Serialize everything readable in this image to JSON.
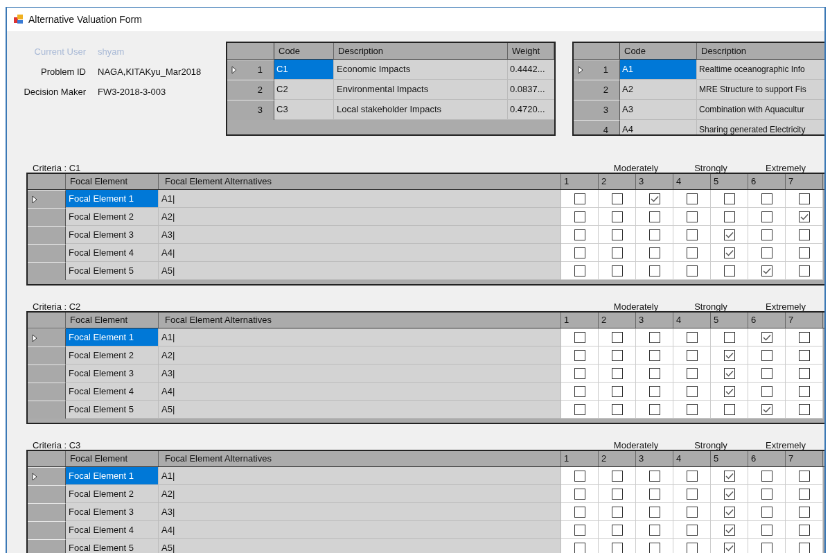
{
  "window": {
    "title": "Alternative Valuation Form"
  },
  "info": [
    {
      "label": "Current User",
      "value": "shyam",
      "disabled": true
    },
    {
      "label": "Problem ID",
      "value": "NAGA,KITAKyu_Mar2018",
      "disabled": false
    },
    {
      "label": "Decision Maker",
      "value": "FW3-2018-3-003",
      "disabled": false
    }
  ],
  "criteria_table": {
    "columns": [
      "Code",
      "Description",
      "Weight"
    ],
    "rows": [
      {
        "number": "1",
        "code": "C1",
        "description": "Economic Impacts",
        "weight": "0.4442...",
        "selected": true
      },
      {
        "number": "2",
        "code": "C2",
        "description": "Environmental Impacts",
        "weight": "0.0837...",
        "selected": false
      },
      {
        "number": "3",
        "code": "C3",
        "description": "Local stakeholder Impacts",
        "weight": "0.4720...",
        "selected": false
      }
    ]
  },
  "alternatives_table": {
    "columns": [
      "Code",
      "Description"
    ],
    "rows": [
      {
        "number": "1",
        "code": "A1",
        "description": "Realtime oceanographic Info",
        "selected": true
      },
      {
        "number": "2",
        "code": "A2",
        "description": "MRE Structure to support Fis",
        "selected": false
      },
      {
        "number": "3",
        "code": "A3",
        "description": "Combination with Aquacultur",
        "selected": false
      },
      {
        "number": "4",
        "code": "A4",
        "description": "Sharing generated Electricity",
        "selected": false
      }
    ]
  },
  "sections": [
    {
      "title": "Criteria : C1",
      "scale_labels": [
        "Moderately",
        "Strongly",
        "Extremely"
      ],
      "columns": [
        "Focal Element",
        "Focal Element Alternatives",
        "1",
        "2",
        "3",
        "4",
        "5",
        "6",
        "7"
      ],
      "rows": [
        {
          "element": "Focal Element 1",
          "alternatives": "A1|",
          "selected": true,
          "ratings": [
            false,
            false,
            true,
            false,
            false,
            false,
            false
          ]
        },
        {
          "element": "Focal Element 2",
          "alternatives": "A2|",
          "selected": false,
          "ratings": [
            false,
            false,
            false,
            false,
            false,
            false,
            true
          ]
        },
        {
          "element": "Focal Element 3",
          "alternatives": "A3|",
          "selected": false,
          "ratings": [
            false,
            false,
            false,
            false,
            true,
            false,
            false
          ]
        },
        {
          "element": "Focal Element 4",
          "alternatives": "A4|",
          "selected": false,
          "ratings": [
            false,
            false,
            false,
            false,
            true,
            false,
            false
          ]
        },
        {
          "element": "Focal Element 5",
          "alternatives": "A5|",
          "selected": false,
          "ratings": [
            false,
            false,
            false,
            false,
            false,
            true,
            false
          ]
        }
      ]
    },
    {
      "title": "Criteria : C2",
      "scale_labels": [
        "Moderately",
        "Strongly",
        "Extremely"
      ],
      "columns": [
        "Focal Element",
        "Focal Element Alternatives",
        "1",
        "2",
        "3",
        "4",
        "5",
        "6",
        "7"
      ],
      "rows": [
        {
          "element": "Focal Element 1",
          "alternatives": "A1|",
          "selected": true,
          "ratings": [
            false,
            false,
            false,
            false,
            false,
            true,
            false
          ]
        },
        {
          "element": "Focal Element 2",
          "alternatives": "A2|",
          "selected": false,
          "ratings": [
            false,
            false,
            false,
            false,
            true,
            false,
            false
          ]
        },
        {
          "element": "Focal Element 3",
          "alternatives": "A3|",
          "selected": false,
          "ratings": [
            false,
            false,
            false,
            false,
            true,
            false,
            false
          ]
        },
        {
          "element": "Focal Element 4",
          "alternatives": "A4|",
          "selected": false,
          "ratings": [
            false,
            false,
            false,
            false,
            true,
            false,
            false
          ]
        },
        {
          "element": "Focal Element 5",
          "alternatives": "A5|",
          "selected": false,
          "ratings": [
            false,
            false,
            false,
            false,
            false,
            true,
            false
          ]
        }
      ]
    },
    {
      "title": "Criteria : C3",
      "scale_labels": [
        "Moderately",
        "Strongly",
        "Extremely"
      ],
      "columns": [
        "Focal Element",
        "Focal Element Alternatives",
        "1",
        "2",
        "3",
        "4",
        "5",
        "6",
        "7"
      ],
      "rows": [
        {
          "element": "Focal Element 1",
          "alternatives": "A1|",
          "selected": true,
          "ratings": [
            false,
            false,
            false,
            false,
            true,
            false,
            false
          ]
        },
        {
          "element": "Focal Element 2",
          "alternatives": "A2|",
          "selected": false,
          "ratings": [
            false,
            false,
            false,
            false,
            true,
            false,
            false
          ]
        },
        {
          "element": "Focal Element 3",
          "alternatives": "A3|",
          "selected": false,
          "ratings": [
            false,
            false,
            false,
            false,
            true,
            false,
            false
          ]
        },
        {
          "element": "Focal Element 4",
          "alternatives": "A4|",
          "selected": false,
          "ratings": [
            false,
            false,
            false,
            false,
            true,
            false,
            false
          ]
        },
        {
          "element": "Focal Element 5",
          "alternatives": "A5|",
          "selected": false,
          "ratings": [
            false,
            false,
            false,
            false,
            true,
            false,
            false
          ]
        }
      ]
    }
  ]
}
